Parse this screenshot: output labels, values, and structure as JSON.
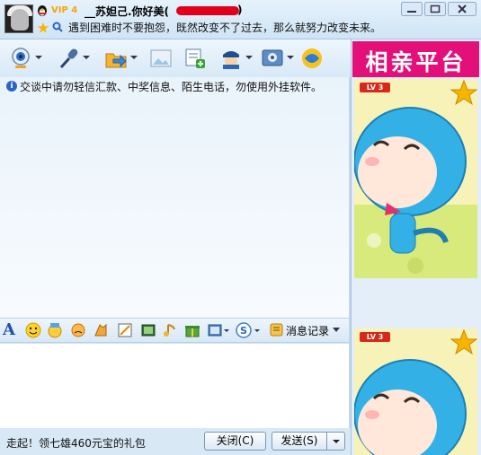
{
  "title_bar": {
    "vip_badge": "VIP 4",
    "contact_name": "__苏妲己.你好美(",
    "contact_name_end": ")",
    "signature": "遇到困难时不要抱怨，既然改变不了过去，那么就努力改变未来。"
  },
  "toolbar": {
    "items": [
      "video-call",
      "voice-call",
      "send-file",
      "send-picture",
      "add-group",
      "remote-assist",
      "app-tools",
      "qq-space"
    ]
  },
  "chat": {
    "notice": "交谈中请勿轻信汇款、中奖信息、陌生电话，勿使用外挂软件。"
  },
  "format_bar": {
    "font_label": "A",
    "history_label": "消息记录"
  },
  "footer": {
    "message": "走起！领七雄460元宝的礼包",
    "close_label": "关闭(C)",
    "send_label": "发送(S)"
  },
  "right_panel": {
    "ad_banner": "相亲平台",
    "level_badge": "LV 3",
    "level_badge_2": "LV 3"
  },
  "colors": {
    "accent": "#2a64c4",
    "ad_banner": "#e3107a",
    "vip": "#f7a400",
    "redaction": "#e0001b"
  }
}
